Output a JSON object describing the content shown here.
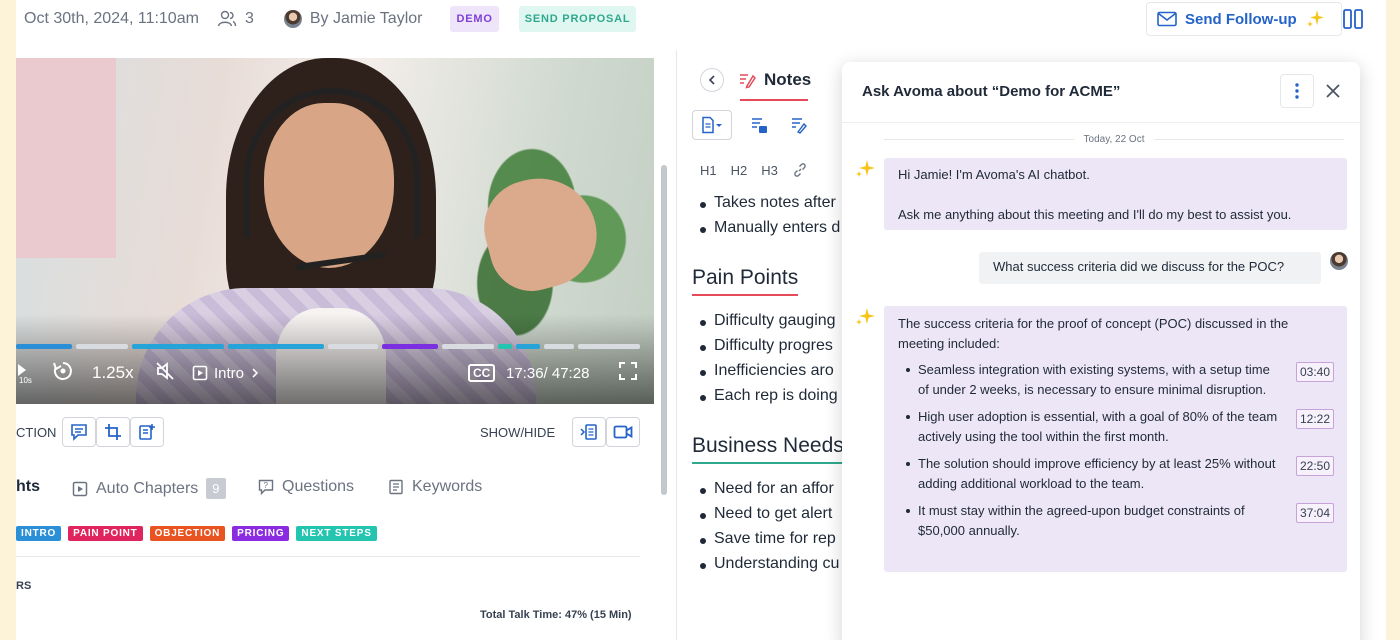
{
  "header": {
    "date": "Oct 30th, 2024, 11:10am",
    "attendee_count": "3",
    "host": "By Jamie Taylor",
    "tags": [
      "DEMO",
      "SEND PROPOSAL"
    ],
    "followup_label": "Send Follow-up"
  },
  "video": {
    "speed": "1.25x",
    "chapter": "Intro",
    "time": "17:36/ 47:28",
    "rewind_label": "10s",
    "cc_label": "CC"
  },
  "video_toolbar": {
    "left_label": "CTION",
    "right_label": "SHOW/HIDE"
  },
  "tabs": {
    "highlights": "hts",
    "auto_chapters": "Auto Chapters",
    "auto_chapters_count": "9",
    "questions": "Questions",
    "keywords": "Keywords"
  },
  "chips": [
    {
      "label": "INTRO",
      "color": "#2a8fd6"
    },
    {
      "label": "PAIN POINT",
      "color": "#e0245e"
    },
    {
      "label": "OBJECTION",
      "color": "#e8531f"
    },
    {
      "label": "PRICING",
      "color": "#8a2be2"
    },
    {
      "label": "NEXT STEPS",
      "color": "#23c4b0"
    }
  ],
  "speakers_label": "RS",
  "talk_time": "Total Talk Time: 47% (15 Min)",
  "notes": {
    "tab_label": "Notes",
    "format_buttons": [
      "H1",
      "H2",
      "H3"
    ],
    "items_top": [
      "Takes notes after",
      "Manually enters d"
    ],
    "heading_pain": "Pain Points",
    "items_pain": [
      "Difficulty gauging",
      "Difficulty progres",
      "Inefficiencies aro",
      "Each rep is doing"
    ],
    "heading_business": "Business Needs",
    "items_business": [
      "Need for an affor",
      "Need to get alert",
      "Save time for rep",
      "Understanding cu"
    ]
  },
  "chat": {
    "title": "Ask Avoma about “Demo for ACME”",
    "date_separator": "Today, 22 Oct",
    "bot_greeting_1": "Hi Jamie! I'm Avoma's AI chatbot.",
    "bot_greeting_2": "Ask me anything about this meeting and I'll do my best to assist you.",
    "user_question": "What success criteria did we discuss for the POC?",
    "answer_intro": "The success criteria for the proof of concept (POC) discussed in the meeting included:",
    "criteria": [
      {
        "text": "Seamless integration with existing systems, with a setup time of under 2 weeks, is necessary to ensure minimal disruption.",
        "time": "03:40"
      },
      {
        "text": "High user adoption is essential, with a goal of 80% of the team actively using the tool within the first month.",
        "time": "12:22"
      },
      {
        "text": "The solution should improve efficiency by at least 25% without adding additional workload to the team.",
        "time": "22:50"
      },
      {
        "text": "It must stay within the agreed-upon budget constraints of $50,000 annually.",
        "time": "37:04"
      }
    ]
  },
  "colors": {
    "accent_blue": "#2563c9",
    "notes_red": "#e64a5b",
    "teal": "#2fa98d",
    "bot_bubble": "#ece6f7",
    "sparkle": "#f5c518"
  }
}
